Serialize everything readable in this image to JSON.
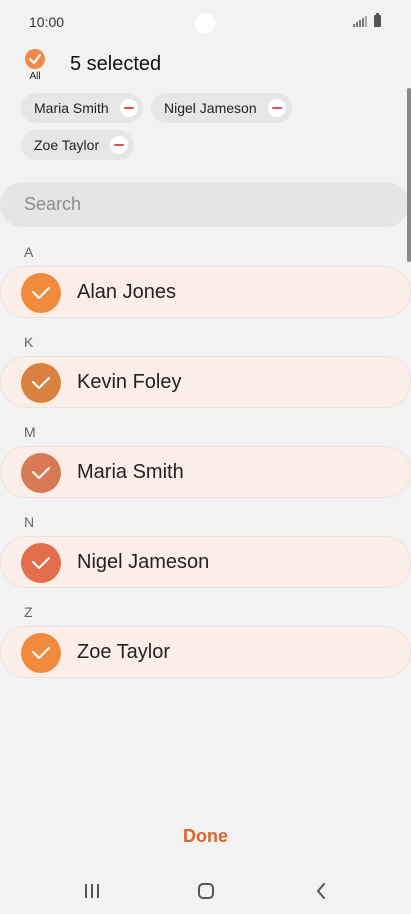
{
  "status_bar": {
    "time": "10:00",
    "signal_icon": "signal-icon",
    "battery_icon": "battery-icon"
  },
  "header": {
    "all_label": "All",
    "selected_count": "5 selected"
  },
  "chips": [
    {
      "label": "Maria Smith"
    },
    {
      "label": "Nigel Jameson"
    },
    {
      "label": "Zoe Taylor"
    }
  ],
  "search": {
    "placeholder": "Search"
  },
  "sections": [
    {
      "letter": "A",
      "contact": "Alan Jones",
      "color": "#f08a3c"
    },
    {
      "letter": "K",
      "contact": "Kevin Foley",
      "color": "#d9823f"
    },
    {
      "letter": "M",
      "contact": "Maria Smith",
      "color": "#d77a54"
    },
    {
      "letter": "N",
      "contact": "Nigel Jameson",
      "color": "#e36e4e"
    },
    {
      "letter": "Z",
      "contact": "Zoe Taylor",
      "color": "#f08a3c"
    }
  ],
  "footer": {
    "done_label": "Done"
  },
  "colors": {
    "accent": "#d9662c",
    "selected_row": "#fbeee8",
    "remove_red": "#e84b4b"
  }
}
